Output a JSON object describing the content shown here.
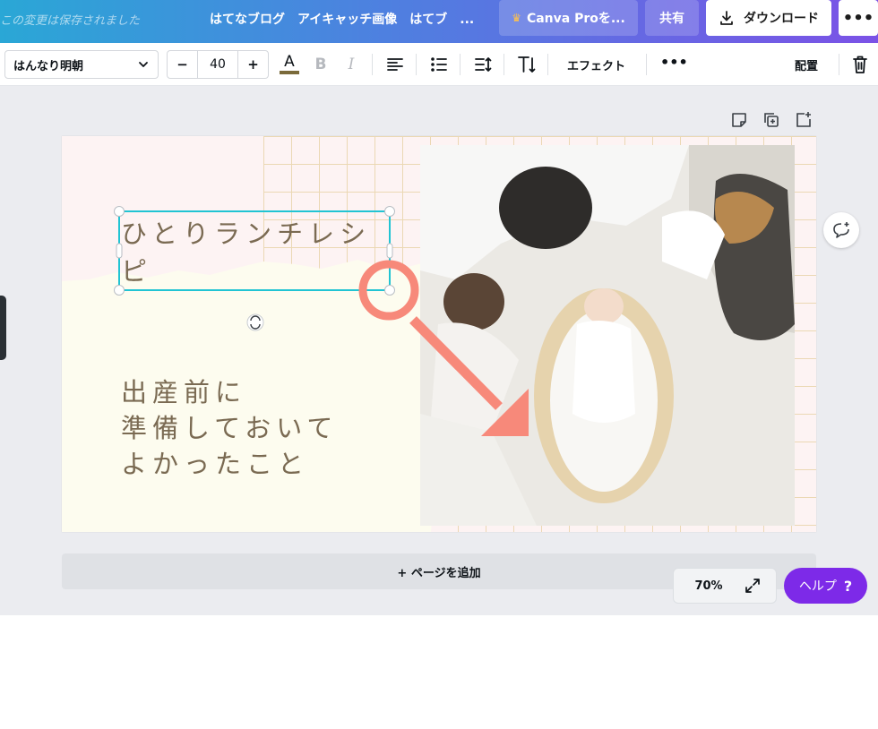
{
  "header": {
    "save_status": "この変更は保存されました",
    "doc_title": "はてなブログ　アイキャッチ画像　はてブ　...",
    "pro_label": "Canva Proを...",
    "share_label": "共有",
    "download_label": "ダウンロード",
    "more_label": "•••"
  },
  "toolbar": {
    "font_name": "はんなり明朝",
    "font_size_minus": "−",
    "font_size": "40",
    "font_size_plus": "+",
    "text_color_glyph": "A",
    "text_color": "#7a6a3a",
    "bold_glyph": "B",
    "italic_glyph": "I",
    "effects_label": "エフェクト",
    "more_label": "•••",
    "position_label": "配置"
  },
  "canvas": {
    "heading": "ひとりランチレシピ",
    "subtitle_lines": [
      "出産前に",
      "準備しておいて",
      "よかったこと"
    ],
    "accent_color": "#f7897a"
  },
  "footer": {
    "add_page_label": "+ ページを追加",
    "zoom": "70%",
    "help_label": "ヘルプ",
    "help_icon": "?"
  }
}
